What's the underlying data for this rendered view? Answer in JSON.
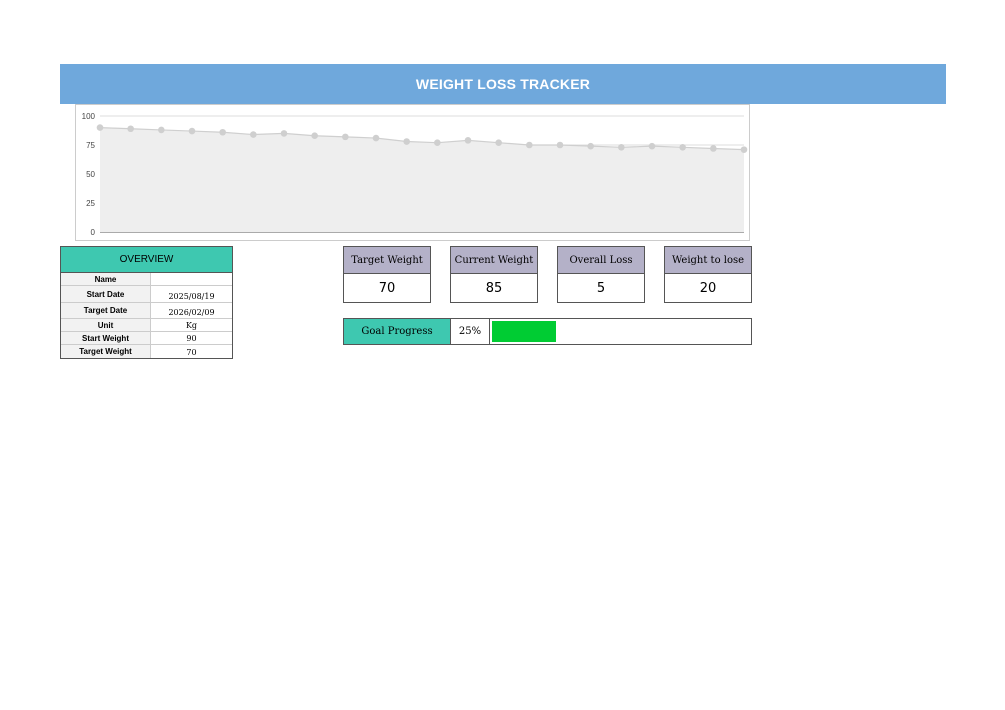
{
  "header": {
    "title": "WEIGHT LOSS TRACKER"
  },
  "overview": {
    "title": "OVERVIEW",
    "rows": [
      {
        "label": "Name",
        "value": ""
      },
      {
        "label": "Start Date",
        "value": "2025/08/19"
      },
      {
        "label": "Target Date",
        "value": "2026/02/09"
      },
      {
        "label": "Unit",
        "value": "Kg"
      },
      {
        "label": "Start Weight",
        "value": "90"
      },
      {
        "label": "Target Weight",
        "value": "70"
      }
    ]
  },
  "kpis": {
    "target_weight": {
      "label": "Target Weight",
      "value": "70"
    },
    "current_weight": {
      "label": "Current Weight",
      "value": "85"
    },
    "overall_loss": {
      "label": "Overall Loss",
      "value": "5"
    },
    "weight_to_lose": {
      "label": "Weight to lose",
      "value": "20"
    }
  },
  "goal": {
    "label": "Goal Progress",
    "percent_text": "25%",
    "progress_fraction": 0.25,
    "fill_color": "#00cc33"
  },
  "colors": {
    "banner": "#6fa8dc",
    "overview_header": "#3ec8b0",
    "kpi_header": "#b4b1c8",
    "series_line": "#cfcfcf",
    "series_area": "#eeeeee"
  },
  "chart_data": {
    "type": "area",
    "title": "",
    "xlabel": "",
    "ylabel": "",
    "ylim": [
      0,
      100
    ],
    "yticks": [
      "0",
      "25",
      "50",
      "75",
      "100"
    ],
    "grid": true,
    "series": [
      {
        "values": [
          90,
          89,
          88,
          87,
          86,
          84,
          85,
          83,
          82,
          81,
          78,
          77,
          79,
          77,
          75,
          75,
          74,
          73,
          74,
          73,
          72,
          71
        ]
      }
    ]
  }
}
